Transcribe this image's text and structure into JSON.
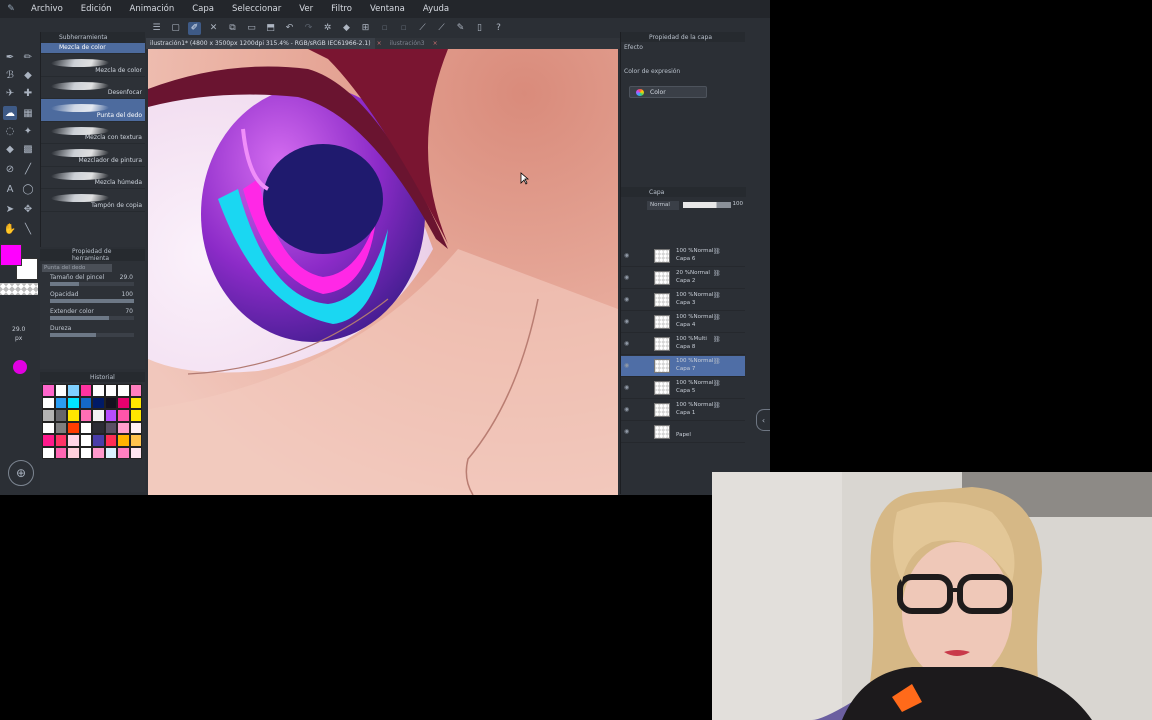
{
  "menu": {
    "items": [
      "Archivo",
      "Edición",
      "Animación",
      "Capa",
      "Seleccionar",
      "Ver",
      "Filtro",
      "Ventana",
      "Ayuda"
    ]
  },
  "document": {
    "tab_title": "ilustración1* (4800 x 3500px 1200dpi 315.4%  - RGB/sRGB IEC61966-2.1)",
    "tab_other": "ilustración3"
  },
  "subtool": {
    "header": "Subherramienta",
    "group": "Mezcla de color",
    "brushes": [
      {
        "name": "Mezcla de color",
        "selected": false
      },
      {
        "name": "Desenfocar",
        "selected": false
      },
      {
        "name": "Punta del dedo",
        "selected": true
      },
      {
        "name": "Mezcla con textura",
        "selected": false
      },
      {
        "name": "Mezclador de pintura",
        "selected": false
      },
      {
        "name": "Mezcla húmeda",
        "selected": false
      },
      {
        "name": "Tampón de copia",
        "selected": false
      }
    ]
  },
  "toolprop": {
    "header": "Propiedad de herramienta",
    "tool_name": "Punta del dedo",
    "props": [
      {
        "label": "Tamaño del pincel",
        "value": "29.0",
        "fill": 0.35
      },
      {
        "label": "Opacidad",
        "value": "100",
        "fill": 1.0
      },
      {
        "label": "Extender color",
        "value": "70",
        "fill": 0.7
      },
      {
        "label": "Dureza",
        "value": "",
        "fill": 0.55
      }
    ]
  },
  "brush_size": {
    "value": "29.0",
    "unit": "px"
  },
  "colorset": {
    "header": "Historial",
    "colors": [
      "#ff66cc",
      "#ffffff",
      "#7fd0ff",
      "#ff33a1",
      "#ffffff",
      "#ffffff",
      "#ffffff",
      "#ff7fbf",
      "#ffffff",
      "#2a9df4",
      "#00e5ff",
      "#1469c7",
      "#001a66",
      "#14121f",
      "#e6006e",
      "#ffe600",
      "#b3b3b3",
      "#66666b",
      "#ffe600",
      "#ff6fb5",
      "#f2f2f2",
      "#b84dff",
      "#ff55aa",
      "#ffe600",
      "#ffffff",
      "#7f7f7f",
      "#ff3d00",
      "#ffffff",
      "#2b2b33",
      "#5a4f63",
      "#ff9fcc",
      "#fff0f5",
      "#ff1a8c",
      "#ff3366",
      "#ffd6e6",
      "#ffffff",
      "#4a3da8",
      "#ff2d55",
      "#ffb300",
      "#ffc34d",
      "#ffffff",
      "#ff66b3",
      "#ffd1dc",
      "#ffffff",
      "#ff99cc",
      "#d9f2ff",
      "#ff80c0",
      "#ffe6f0"
    ]
  },
  "right_panel": {
    "prop_header": "Propiedad de la capa",
    "efecto": "Efecto",
    "expr_label": "Color de expresión",
    "expr_value": "Color",
    "layer_header": "Capa",
    "blend": "Normal",
    "opacity": "100",
    "layers": [
      {
        "opacity": "100 %Normal",
        "name": "Capa 6",
        "selected": false
      },
      {
        "opacity": "20 %Normal",
        "name": "Capa 2",
        "selected": false
      },
      {
        "opacity": "100 %Normal",
        "name": "Capa 3",
        "selected": false
      },
      {
        "opacity": "100 %Normal",
        "name": "Capa 4",
        "selected": false
      },
      {
        "opacity": "100 %Multi",
        "name": "Capa 8",
        "selected": false
      },
      {
        "opacity": "100 %Normal",
        "name": "Capa 7",
        "selected": true
      },
      {
        "opacity": "100 %Normal",
        "name": "Capa 5",
        "selected": false
      },
      {
        "opacity": "100 %Normal",
        "name": "Capa 1",
        "selected": false
      },
      {
        "opacity": "",
        "name": "Papel",
        "selected": false
      }
    ]
  },
  "icons": {
    "app_logo": "paintbrush-icon",
    "tool_items": [
      "pen-icon",
      "brush-icon",
      "eraser-icon",
      "blend-icon",
      "fill-icon",
      "gradient-icon",
      "text-icon",
      "shape-icon",
      "select-icon",
      "move-icon",
      "eyedropper-icon",
      "hand-icon"
    ]
  }
}
